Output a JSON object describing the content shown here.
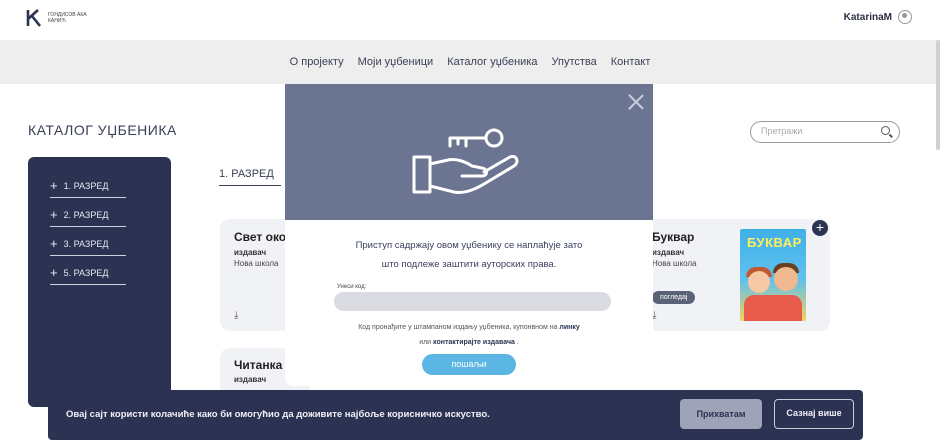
{
  "header": {
    "logo_text": "ГОНДИСОВ АКА КАНИЋ",
    "username": "KatarinaM"
  },
  "nav": {
    "items": [
      "О пројекту",
      "Моји уџбеници",
      "Каталог уџбеника",
      "Упутства",
      "Контакт"
    ]
  },
  "catalog": {
    "title": "КАТАЛОГ УЏБЕНИКА",
    "search_placeholder": "Претражи",
    "active_grade": "1. РАЗРЕД"
  },
  "sidebar": {
    "items": [
      {
        "label": "1. РАЗРЕД"
      },
      {
        "label": "2. РАЗРЕД"
      },
      {
        "label": "3. РАЗРЕД"
      },
      {
        "label": "5. РАЗРЕД"
      }
    ]
  },
  "cards": [
    {
      "title": "Свет око",
      "publisher_label": "издавач",
      "publisher": "Нова школа"
    },
    {
      "title": "Буквар",
      "publisher_label": "издавач",
      "publisher": "Нова школа",
      "preview": "погледај"
    },
    {
      "title": "Читанка",
      "publisher_label": "издавач",
      "publisher": ""
    }
  ],
  "book_cover_word": "БУКВАР",
  "modal": {
    "message_line1": "Приступ садржају овом уџбенику се наплаћује зато",
    "message_line2": "што подлеже заштити ауторских права.",
    "code_label": "Унеси код:",
    "help_part1": "Код пронађите у штампаном издању уџбеника, купонвном на",
    "help_link1": "линку",
    "help_part2": "или",
    "help_link2": "контактирајте издавача",
    "help_end": ".",
    "send_button": "пошаљи"
  },
  "cookie": {
    "text": "Овај сајт користи колачиће како би омогућио да доживите најбоље корисничко искуство.",
    "accept": "Прихватам",
    "more": "Сазнај више"
  },
  "colors": {
    "navy": "#2c3352",
    "modal_header": "#6b7491",
    "accent_blue": "#5bb6e4"
  }
}
